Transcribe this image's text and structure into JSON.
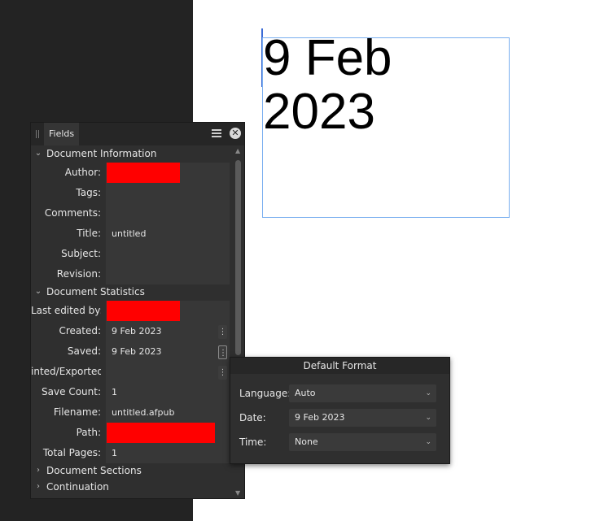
{
  "canvas": {
    "text_frame_text": "9 Feb\n2023"
  },
  "panel": {
    "tab_label": "Fields",
    "sections": {
      "document_information": "Document Information",
      "document_statistics": "Document Statistics",
      "document_sections": "Document Sections",
      "continuation": "Continuation"
    },
    "info_rows": [
      {
        "label": "Author:",
        "value": ""
      },
      {
        "label": "Tags:",
        "value": ""
      },
      {
        "label": "Comments:",
        "value": ""
      },
      {
        "label": "Title:",
        "value": "untitled"
      },
      {
        "label": "Subject:",
        "value": ""
      },
      {
        "label": "Revision:",
        "value": ""
      }
    ],
    "stats_rows": [
      {
        "label": "Last edited by:",
        "value": ""
      },
      {
        "label": "Created:",
        "value": "9 Feb 2023"
      },
      {
        "label": "Saved:",
        "value": "9 Feb 2023"
      },
      {
        "label": "inted/Exported:",
        "value": ""
      },
      {
        "label": "Save Count:",
        "value": "1"
      },
      {
        "label": "Filename:",
        "value": "untitled.afpub"
      },
      {
        "label": "Path:",
        "value": ""
      },
      {
        "label": "Total Pages:",
        "value": "1"
      }
    ]
  },
  "popup": {
    "title": "Default Format",
    "rows": [
      {
        "label": "Language:",
        "value": "Auto"
      },
      {
        "label": "Date:",
        "value": "9 Feb 2023"
      },
      {
        "label": "Time:",
        "value": "None"
      }
    ]
  },
  "colors": {
    "panel_bg": "#2f2f2f",
    "redaction": "#ff0000",
    "frame_border": "#7aaff0"
  }
}
